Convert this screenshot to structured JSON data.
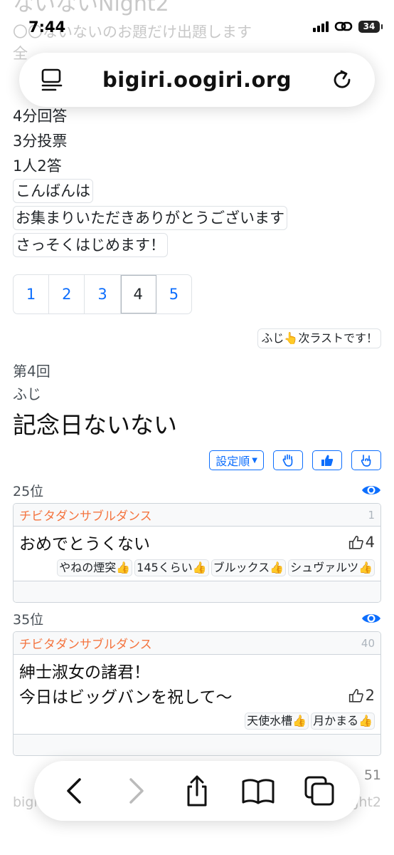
{
  "background_page": {
    "title_partial": "ないないNight2",
    "subtitle_partial": "〇〇ないないのお題だけ出題します",
    "line_partial": "全",
    "footer_left": "bigi",
    "footer_right": "ght2",
    "footer_vote_count": "51"
  },
  "status_bar": {
    "time": "7:44",
    "battery": "34"
  },
  "url_bar": {
    "domain": "bigiri.oogiri.org"
  },
  "rules": [
    "4分回答",
    "3分投票",
    "1人2答"
  ],
  "greetings": [
    "こんばんは",
    "お集まりいただきありがとうございます",
    "さっそくはじめます！"
  ],
  "pagination": {
    "pages": [
      "1",
      "2",
      "3",
      "4",
      "5"
    ],
    "current": "4"
  },
  "announcement": "ふじ👆次ラストです！",
  "round": {
    "label": "第4回",
    "host": "ふじ",
    "theme": "記念日ないない"
  },
  "toolbar": {
    "sort_label": "設定順"
  },
  "answers": [
    {
      "rank": "25位",
      "user": "チビタダンサブルダンス",
      "number": "1",
      "lines": [
        "おめでとうくない"
      ],
      "votes": "4",
      "voters": [
        "やねの煙突",
        "145くらい",
        "ブルックス",
        "シュヴァルツ"
      ]
    },
    {
      "rank": "35位",
      "user": "チビタダンサブルダンス",
      "number": "40",
      "lines": [
        "紳士淑女の諸君！",
        "今日はビッグバンを祝して〜"
      ],
      "votes": "2",
      "voters": [
        "天使水槽",
        "月かまる"
      ]
    }
  ],
  "colors": {
    "link": "#0d6efd",
    "username": "#f47540"
  }
}
